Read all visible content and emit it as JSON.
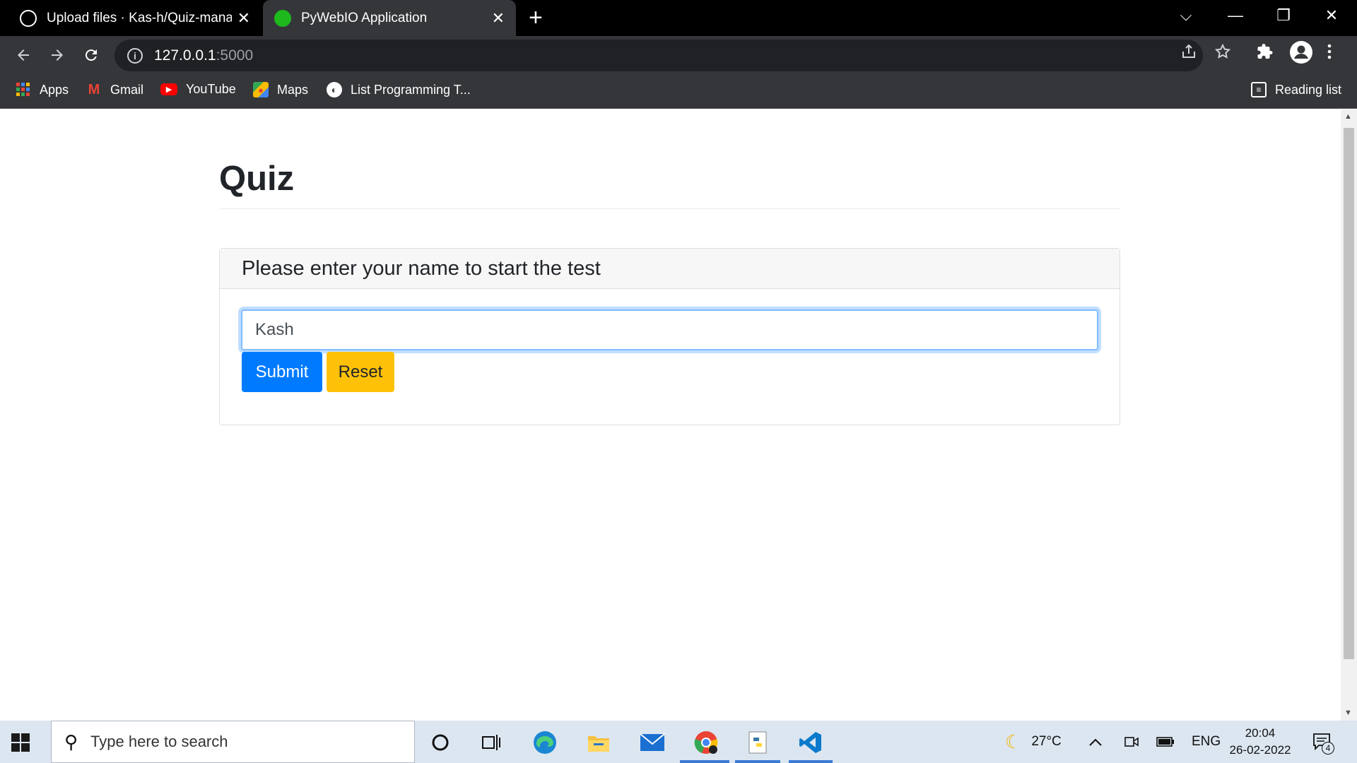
{
  "browser": {
    "tabs": [
      {
        "title": "Upload files · Kas-h/Quiz-manag",
        "active": false,
        "favicon": "github-icon"
      },
      {
        "title": "PyWebIO Application",
        "active": true,
        "favicon": "green-circle-icon"
      }
    ],
    "new_tab": "+",
    "window_controls": {
      "tab_search": "⌵",
      "minimize": "—",
      "restore": "❐",
      "close": "✕"
    },
    "address": {
      "host": "127.0.0.1",
      "port": ":5000"
    },
    "bookmarks": [
      {
        "label": "Apps",
        "icon": "apps-grid-icon"
      },
      {
        "label": "Gmail",
        "icon": "gmail-icon"
      },
      {
        "label": "YouTube",
        "icon": "youtube-icon"
      },
      {
        "label": "Maps",
        "icon": "maps-icon"
      },
      {
        "label": "List Programming T...",
        "icon": "globe-icon"
      }
    ],
    "reading_list": "Reading list"
  },
  "page": {
    "title": "Quiz",
    "card_header": "Please enter your name to start the test",
    "name_value": "Kash",
    "submit_label": "Submit",
    "reset_label": "Reset"
  },
  "taskbar": {
    "search_placeholder": "Type here to search",
    "weather": "27°C",
    "language": "ENG",
    "time": "20:04",
    "date": "26-02-2022",
    "notification_count": "4"
  },
  "colors": {
    "primary": "#007bff",
    "warning": "#ffc107",
    "chrome_dark": "#35363a",
    "tab_bar": "#000000",
    "taskbar": "#dce6f1"
  }
}
